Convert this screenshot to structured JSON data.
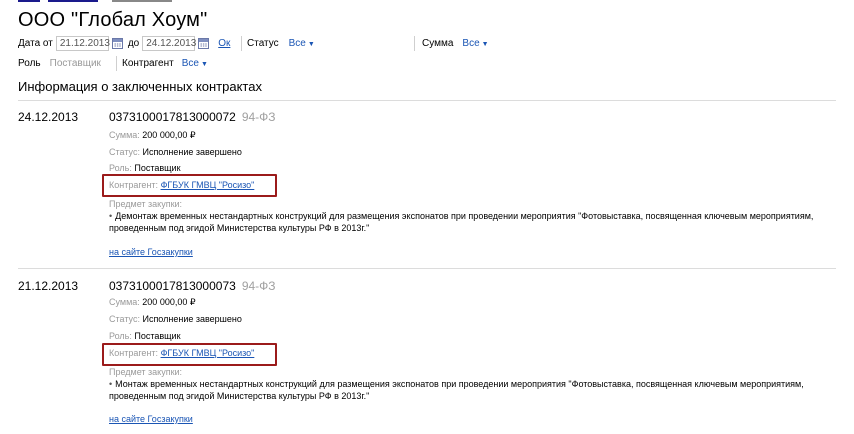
{
  "company": {
    "name": "ООО \"Глобал Хоум\""
  },
  "filters": {
    "date_from_label": "Дата от",
    "date_from": "21.12.2013",
    "date_to_label": "до",
    "date_to": "24.12.2013",
    "ok_label": "Ок",
    "status_label": "Статус",
    "status_value": "Все",
    "sum_label": "Сумма",
    "sum_value": "Все",
    "role_label": "Роль",
    "role_value": "Поставщик",
    "counterparty_label": "Контрагент",
    "counterparty_value": "Все"
  },
  "section_title": "Информация о заключенных контрактах",
  "contracts": [
    {
      "date": "24.12.2013",
      "number": "0373100017813000072",
      "law": "94-ФЗ",
      "sum_label": "Сумма:",
      "sum": "200 000,00 ₽",
      "status_label": "Статус:",
      "status": "Исполнение завершено",
      "role_label": "Роль:",
      "role": "Поставщик",
      "counterparty_label": "Контрагент:",
      "counterparty": "ФГБУК ГМВЦ \"Росизо\"",
      "subject_label": "Предмет закупки:",
      "subject_line1": "Демонтаж временных нестандартных конструкций для размещения экспонатов при проведении мероприятия \"Фотовыставка, посвященная ключевым мероприятиям,",
      "subject_line2": "проведенным под эгидой Министерства культуры РФ в 2013г.\"",
      "link": "на сайте Госзакупки"
    },
    {
      "date": "21.12.2013",
      "number": "0373100017813000073",
      "law": "94-ФЗ",
      "sum_label": "Сумма:",
      "sum": "200 000,00 ₽",
      "status_label": "Статус:",
      "status": "Исполнение завершено",
      "role_label": "Роль:",
      "role": "Поставщик",
      "counterparty_label": "Контрагент:",
      "counterparty": "ФГБУК ГМВЦ \"Росизо\"",
      "subject_label": "Предмет закупки:",
      "subject_line1": "Монтаж временных нестандартных конструкций для размещения экспонатов при проведении мероприятия \"Фотовыставка, посвященная ключевым мероприятиям,",
      "subject_line2": "проведенным под эгидой Министерства культуры РФ в 2013г.\"",
      "link": "на сайте Госзакупки"
    }
  ]
}
